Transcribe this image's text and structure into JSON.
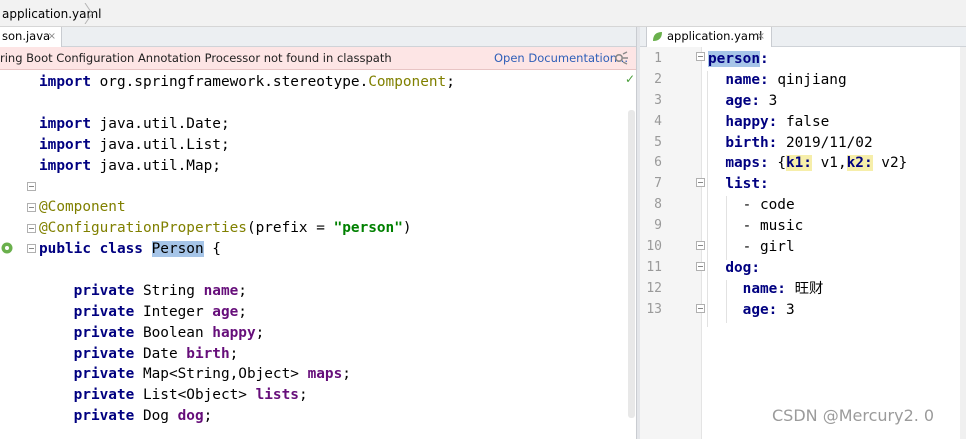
{
  "breadcrumb": {
    "label": "application.yaml"
  },
  "left_tab": {
    "label": "son.java",
    "close": "×"
  },
  "banner": {
    "text": "ring Boot Configuration Annotation Processor not found in classpath",
    "link": "Open Documentation..."
  },
  "java_code": [
    [
      {
        "t": "import",
        "c": "kw"
      },
      {
        "t": " org.springframework.stereotype."
      },
      {
        "t": "Component",
        "c": "ann"
      },
      {
        "t": ";"
      }
    ],
    [],
    [
      {
        "t": "import",
        "c": "kw"
      },
      {
        "t": " java.util.Date;"
      }
    ],
    [
      {
        "t": "import",
        "c": "kw"
      },
      {
        "t": " java.util.List;"
      }
    ],
    [
      {
        "t": "import",
        "c": "kw"
      },
      {
        "t": " java.util.Map;"
      }
    ],
    [],
    [
      {
        "t": "@Component",
        "c": "ann"
      }
    ],
    [
      {
        "t": "@ConfigurationProperties",
        "c": "ann"
      },
      {
        "t": "(prefix = "
      },
      {
        "t": "\"person\"",
        "c": "str"
      },
      {
        "t": ")"
      }
    ],
    [
      {
        "t": "public class ",
        "c": "kw"
      },
      {
        "t": "Person",
        "c": "sel"
      },
      {
        "t": " {"
      }
    ],
    [],
    [
      {
        "t": "    "
      },
      {
        "t": "private",
        "c": "kw"
      },
      {
        "t": " String "
      },
      {
        "t": "name",
        "c": "field"
      },
      {
        "t": ";"
      }
    ],
    [
      {
        "t": "    "
      },
      {
        "t": "private",
        "c": "kw"
      },
      {
        "t": " Integer "
      },
      {
        "t": "age",
        "c": "field"
      },
      {
        "t": ";"
      }
    ],
    [
      {
        "t": "    "
      },
      {
        "t": "private",
        "c": "kw"
      },
      {
        "t": " Boolean "
      },
      {
        "t": "happy",
        "c": "field"
      },
      {
        "t": ";"
      }
    ],
    [
      {
        "t": "    "
      },
      {
        "t": "private",
        "c": "kw"
      },
      {
        "t": " Date "
      },
      {
        "t": "birth",
        "c": "field"
      },
      {
        "t": ";"
      }
    ],
    [
      {
        "t": "    "
      },
      {
        "t": "private",
        "c": "kw"
      },
      {
        "t": " Map<String,Object> "
      },
      {
        "t": "maps",
        "c": "field"
      },
      {
        "t": ";"
      }
    ],
    [
      {
        "t": "    "
      },
      {
        "t": "private",
        "c": "kw"
      },
      {
        "t": " List<Object> "
      },
      {
        "t": "lists",
        "c": "field"
      },
      {
        "t": ";"
      }
    ],
    [
      {
        "t": "    "
      },
      {
        "t": "private",
        "c": "kw"
      },
      {
        "t": " Dog "
      },
      {
        "t": "dog",
        "c": "field"
      },
      {
        "t": ";"
      }
    ]
  ],
  "right_tab": {
    "label": "application.yaml",
    "close": "×"
  },
  "yaml_line_numbers": [
    "1",
    "2",
    "3",
    "4",
    "5",
    "6",
    "7",
    "8",
    "9",
    "10",
    "11",
    "12",
    "13"
  ],
  "yaml_code": [
    [
      {
        "t": "person",
        "c": "ykey ykey-sel"
      },
      {
        "t": ":",
        "c": "ykey"
      }
    ],
    [
      {
        "t": "  "
      },
      {
        "t": "name:",
        "c": "ykey"
      },
      {
        "t": " qinjiang"
      }
    ],
    [
      {
        "t": "  "
      },
      {
        "t": "age:",
        "c": "ykey"
      },
      {
        "t": " 3"
      }
    ],
    [
      {
        "t": "  "
      },
      {
        "t": "happy:",
        "c": "ykey"
      },
      {
        "t": " false"
      }
    ],
    [
      {
        "t": "  "
      },
      {
        "t": "birth:",
        "c": "ykey"
      },
      {
        "t": " 2019/11/02"
      }
    ],
    [
      {
        "t": "  "
      },
      {
        "t": "maps:",
        "c": "ykey"
      },
      {
        "t": " {"
      },
      {
        "t": "k1:",
        "c": "ykey ykey-hl"
      },
      {
        "t": " v1,"
      },
      {
        "t": "k2:",
        "c": "ykey ykey-hl"
      },
      {
        "t": " v2}"
      }
    ],
    [
      {
        "t": "  "
      },
      {
        "t": "list:",
        "c": "ykey"
      }
    ],
    [
      {
        "t": "    - code"
      }
    ],
    [
      {
        "t": "    - music"
      }
    ],
    [
      {
        "t": "    - girl"
      }
    ],
    [
      {
        "t": "  "
      },
      {
        "t": "dog:",
        "c": "ykey"
      }
    ],
    [
      {
        "t": "    "
      },
      {
        "t": "name:",
        "c": "ykey"
      },
      {
        "t": " 旺财"
      }
    ],
    [
      {
        "t": "    "
      },
      {
        "t": "age:",
        "c": "ykey"
      },
      {
        "t": " 3"
      }
    ]
  ],
  "watermark": "CSDN @Mercury2. 0"
}
